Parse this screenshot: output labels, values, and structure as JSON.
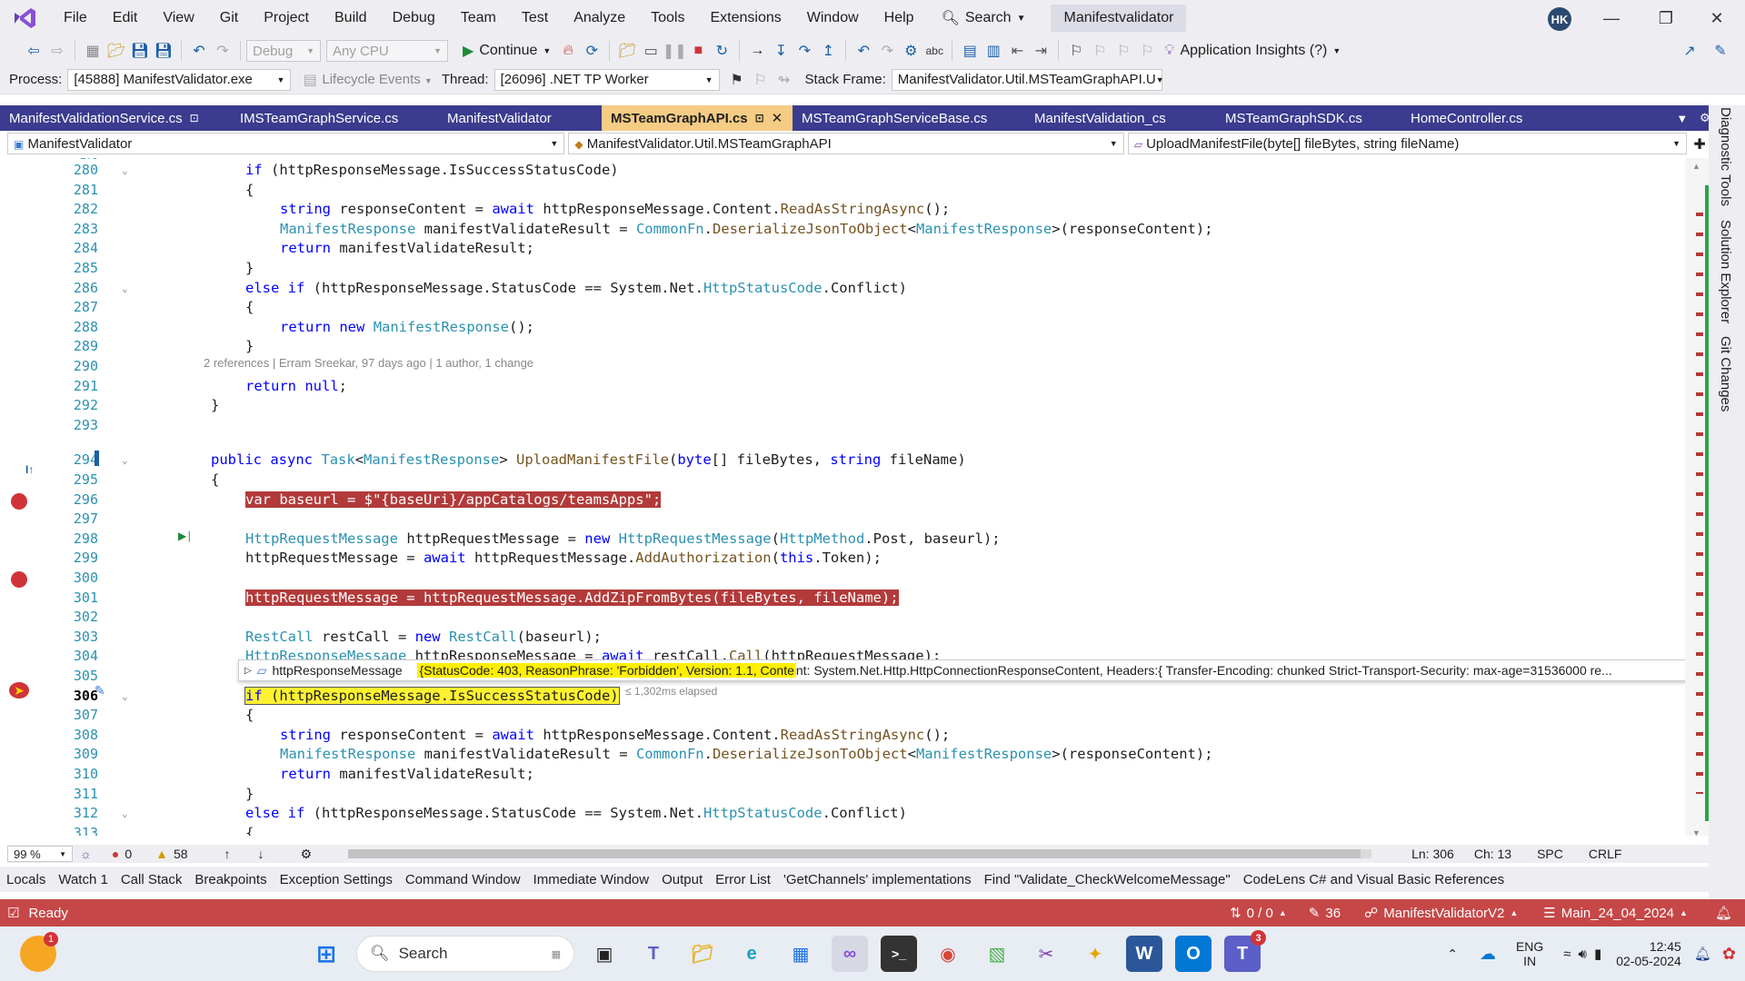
{
  "menubar": {
    "items": [
      "File",
      "Edit",
      "View",
      "Git",
      "Project",
      "Build",
      "Debug",
      "Team",
      "Test",
      "Analyze",
      "Tools",
      "Extensions",
      "Window",
      "Help"
    ],
    "search_label": "Search",
    "solution_name": "Manifestvalidator",
    "avatar_initials": "HK"
  },
  "toolbar1": {
    "config": "Debug",
    "platform": "Any CPU",
    "continue_label": "Continue",
    "app_insights": "Application Insights (?)"
  },
  "toolbar2": {
    "process_label": "Process:",
    "process_value": "[45888] ManifestValidator.exe",
    "lifecycle_label": "Lifecycle Events",
    "thread_label": "Thread:",
    "thread_value": "[26096] .NET TP Worker",
    "stackframe_label": "Stack Frame:",
    "stackframe_value": "ManifestValidator.Util.MSTeamGraphAPI.U"
  },
  "tabs": [
    {
      "label": "ManifestValidationService.cs",
      "pinned": true,
      "active": false
    },
    {
      "label": "IMSTeamGraphService.cs",
      "pinned": false,
      "active": false
    },
    {
      "label": "ManifestValidator",
      "pinned": false,
      "active": false
    },
    {
      "label": "MSTeamGraphAPI.cs",
      "pinned": true,
      "active": true
    },
    {
      "label": "MSTeamGraphServiceBase.cs",
      "pinned": false,
      "active": false
    },
    {
      "label": "ManifestValidation_cs",
      "pinned": false,
      "active": false
    },
    {
      "label": "MSTeamGraphSDK.cs",
      "pinned": false,
      "active": false
    },
    {
      "label": "HomeController.cs",
      "pinned": false,
      "active": false
    }
  ],
  "navbar": {
    "project": "ManifestValidator",
    "type": "ManifestValidator.Util.MSTeamGraphAPI",
    "member": "UploadManifestFile(byte[] fileBytes, string fileName)"
  },
  "side_panel": [
    "Diagnostic Tools",
    "Solution Explorer",
    "Git Changes"
  ],
  "codelens": "2 references | Erram Sreekar, 97 days ago | 1 author, 1 change",
  "code_lines": [
    {
      "n": "280",
      "text": "if (httpResponseMessage.IsSuccessStatusCode)"
    },
    {
      "n": "281",
      "text": "{"
    },
    {
      "n": "282",
      "text": "string responseContent = await httpResponseMessage.Content.ReadAsStringAsync();"
    },
    {
      "n": "283",
      "text": "ManifestResponse manifestValidateResult = CommonFn.DeserializeJsonToObject<ManifestResponse>(responseContent);"
    },
    {
      "n": "284",
      "text": "return manifestValidateResult;"
    },
    {
      "n": "285",
      "text": "}"
    },
    {
      "n": "286",
      "text": "else if (httpResponseMessage.StatusCode == System.Net.HttpStatusCode.Conflict)"
    },
    {
      "n": "287",
      "text": "{"
    },
    {
      "n": "288",
      "text": "return new ManifestResponse();"
    },
    {
      "n": "289",
      "text": "}"
    },
    {
      "n": "290",
      "text": ""
    },
    {
      "n": "291",
      "text": "return null;"
    },
    {
      "n": "292",
      "text": "}"
    },
    {
      "n": "293",
      "text": ""
    },
    {
      "n": "294",
      "text": "public async Task<ManifestResponse> UploadManifestFile(byte[] fileBytes, string fileName)"
    },
    {
      "n": "295",
      "text": "{"
    },
    {
      "n": "296",
      "text": "var baseurl = $\"{baseUri}/appCatalogs/teamsApps\";"
    },
    {
      "n": "297",
      "text": ""
    },
    {
      "n": "298",
      "text": "HttpRequestMessage httpRequestMessage = new HttpRequestMessage(HttpMethod.Post, baseurl);"
    },
    {
      "n": "299",
      "text": "httpRequestMessage = await httpRequestMessage.AddAuthorization(this.Token);"
    },
    {
      "n": "300",
      "text": ""
    },
    {
      "n": "301",
      "text": "httpRequestMessage = httpRequestMessage.AddZipFromBytes(fileBytes, fileName);"
    },
    {
      "n": "302",
      "text": ""
    },
    {
      "n": "303",
      "text": "RestCall restCall = new RestCall(baseurl);"
    },
    {
      "n": "304",
      "text": "HttpResponseMessage httpResponseMessage = await restCall.Call(httpRequestMessage);"
    },
    {
      "n": "305",
      "text": ""
    },
    {
      "n": "306",
      "text": "if (httpResponseMessage.IsSuccessStatusCode)"
    },
    {
      "n": "307",
      "text": "{"
    },
    {
      "n": "308",
      "text": "string responseContent = await httpResponseMessage.Content.ReadAsStringAsync();"
    },
    {
      "n": "309",
      "text": "ManifestResponse manifestValidateResult = CommonFn.DeserializeJsonToObject<ManifestResponse>(responseContent);"
    },
    {
      "n": "310",
      "text": "return manifestValidateResult;"
    },
    {
      "n": "311",
      "text": "}"
    },
    {
      "n": "312",
      "text": "else if (httpResponseMessage.StatusCode == System.Net.HttpStatusCode.Conflict)"
    },
    {
      "n": "313",
      "text": "{"
    }
  ],
  "datatip": {
    "name": "httpResponseMessage",
    "value": "{StatusCode: 403, ReasonPhrase: 'Forbidden', Version: 1.1, Conte",
    "rest": "nt: System.Net.Http.HttpConnectionResponseContent, Headers:{  Transfer-Encoding: chunked  Strict-Transport-Security: max-age=31536000  re..."
  },
  "elapsed": "≤ 1,302ms elapsed",
  "editor_footer": {
    "zoom": "99 %",
    "errors": "0",
    "warnings": "58",
    "line": "Ln: 306",
    "col": "Ch: 13",
    "spc": "SPC",
    "crlf": "CRLF"
  },
  "toolwindows": [
    "Locals",
    "Watch 1",
    "Call Stack",
    "Breakpoints",
    "Exception Settings",
    "Command Window",
    "Immediate Window",
    "Output",
    "Error List",
    "'GetChannels' implementations",
    "Find \"Validate_CheckWelcomeMessage\"",
    "CodeLens C# and Visual Basic References"
  ],
  "statusbar": {
    "ready": "Ready",
    "updown": "0 / 0",
    "pencil": "36",
    "repo": "ManifestValidatorV2",
    "branch": "Main_24_04_2024"
  },
  "taskbar": {
    "search": "Search",
    "lang1": "ENG",
    "lang2": "IN",
    "time": "12:45",
    "date": "02-05-2024",
    "badge_weather": "1",
    "badge_teams": "3"
  },
  "colors": {
    "tab_bar": "#3b3b8f",
    "tab_active": "#f5cc84",
    "status_bar": "#c64747",
    "breakpoint": "#b33a3a",
    "current_line": "#fff230"
  }
}
